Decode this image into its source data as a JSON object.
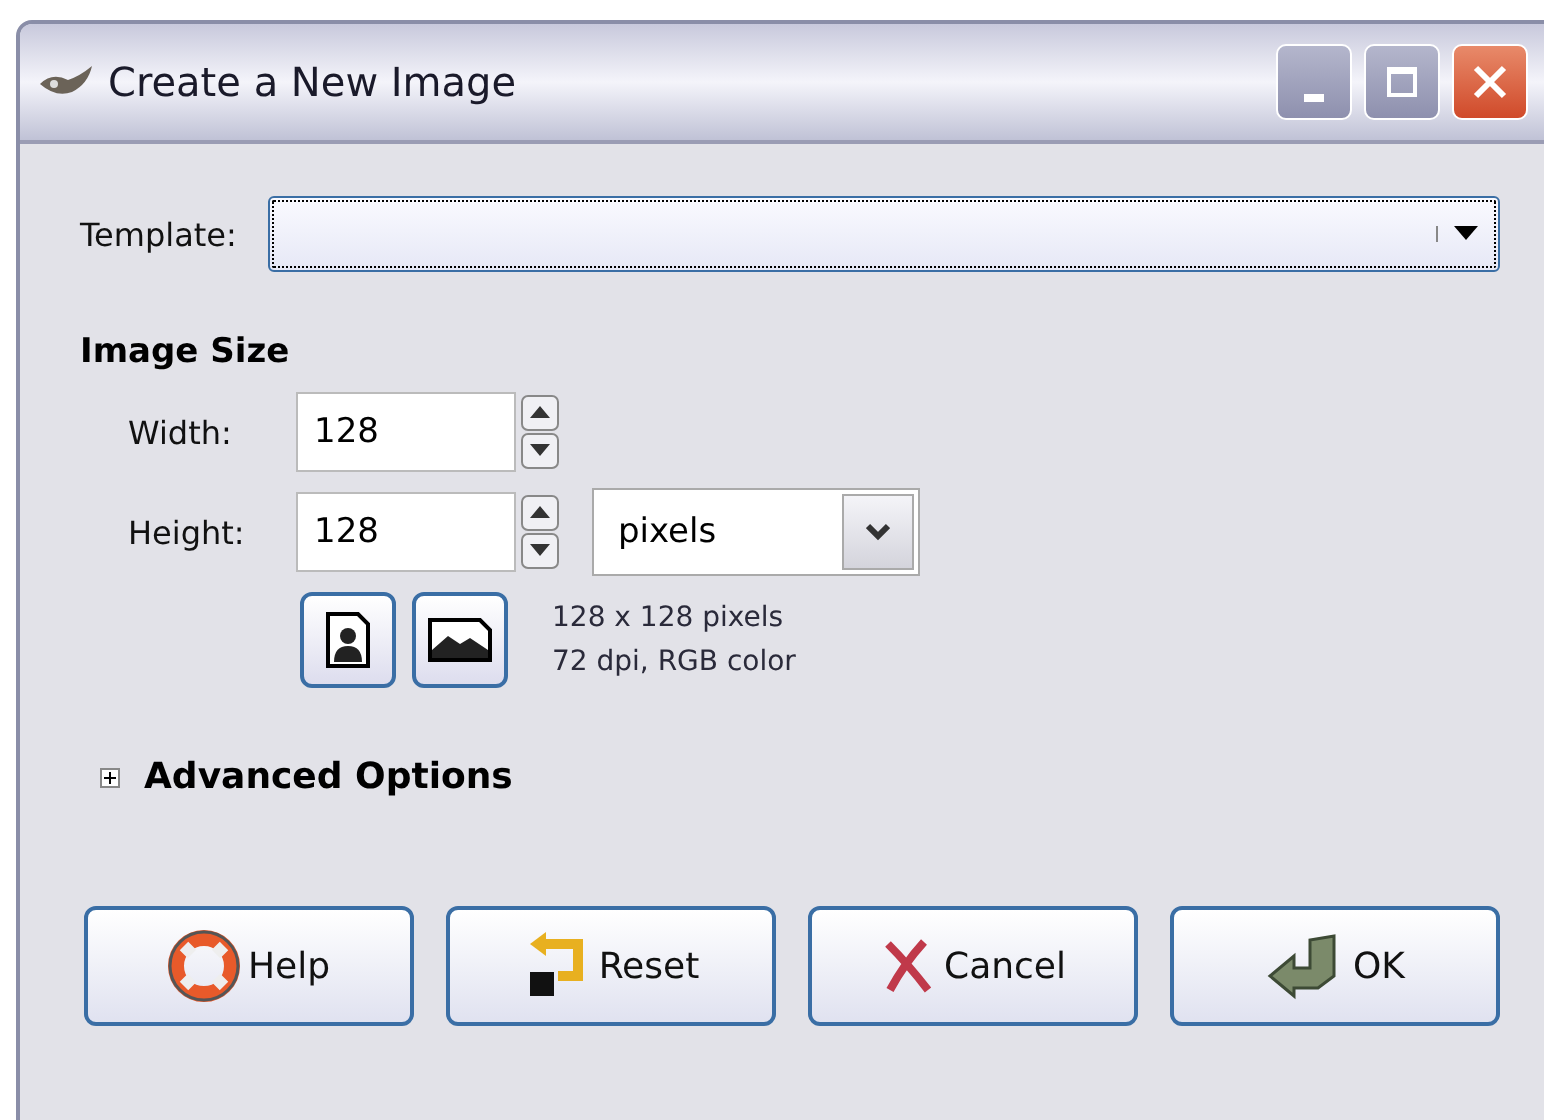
{
  "window": {
    "title": "Create a New Image"
  },
  "template": {
    "label": "Template:"
  },
  "image_size": {
    "heading": "Image Size",
    "fields": [
      {
        "label": "Width:",
        "value": "128"
      },
      {
        "label": "Height:",
        "value": "128"
      }
    ],
    "units": "pixels",
    "info": [
      "128 x 128 pixels",
      "72 dpi, RGB color"
    ]
  },
  "advanced": {
    "label": "Advanced Options",
    "expanded": false
  },
  "buttons": [
    {
      "label": "Help",
      "kind": "help"
    },
    {
      "label": "Reset",
      "kind": "reset"
    },
    {
      "label": "Cancel",
      "kind": "cancel"
    },
    {
      "label": "OK",
      "kind": "ok"
    }
  ]
}
